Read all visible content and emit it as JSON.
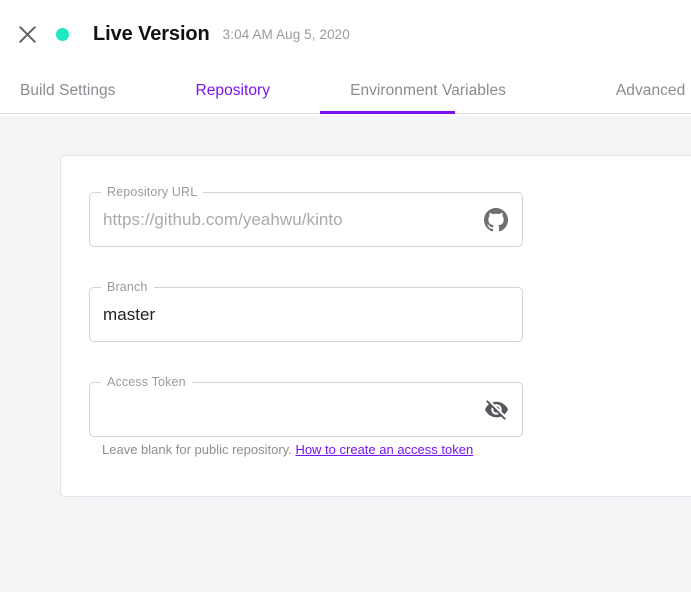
{
  "header": {
    "close_icon": "close-x-icon",
    "status_dot": "live-status-dot",
    "status_color": "#1de9c0",
    "title": "Live Version",
    "timestamp": "3:04 AM Aug 5, 2020"
  },
  "tabs": {
    "accent_color": "#7c11f0",
    "items": [
      {
        "label": "Build Settings",
        "active": false
      },
      {
        "label": "Repository",
        "active": true
      },
      {
        "label": "Environment Variables",
        "active": false
      },
      {
        "label": "Advanced",
        "active": false
      }
    ]
  },
  "form": {
    "repository_url": {
      "label": "Repository URL",
      "value": "",
      "placeholder": "https://github.com/yeahwu/kinto",
      "trailing_icon": "github-icon"
    },
    "branch": {
      "label": "Branch",
      "value": "master",
      "placeholder": ""
    },
    "access_token": {
      "label": "Access Token",
      "value": "",
      "placeholder": "",
      "trailing_icon": "visibility-off-icon",
      "hint_text": "Leave blank for public repository.",
      "hint_link_text": "How to create an access token"
    }
  }
}
